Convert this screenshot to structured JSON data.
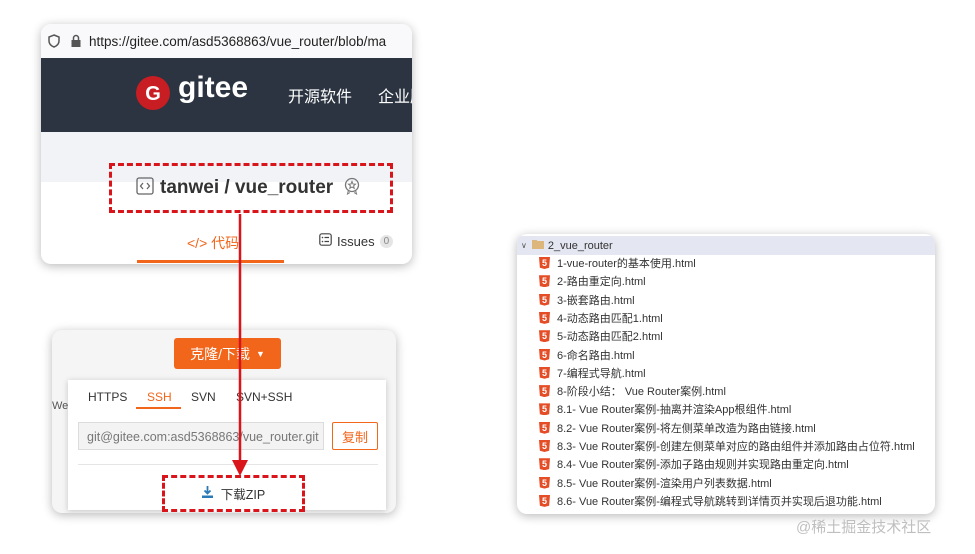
{
  "browser": {
    "url": "https://gitee.com/asd5368863/vue_router/blob/ma",
    "logo_text": "gitee",
    "nav": [
      "开源软件",
      "企业版"
    ],
    "repo_name": "tanwei / vue_router",
    "tab_code": "代码",
    "tab_issues": "Issues",
    "issues_count": "0"
  },
  "clone": {
    "button_label": "克隆/下载",
    "side_text": "We",
    "protocols": [
      "HTTPS",
      "SSH",
      "SVN",
      "SVN+SSH"
    ],
    "active_protocol": "SSH",
    "url_value": "git@gitee.com:asd5368863/vue_router.git",
    "copy_label": "复制",
    "download_zip_label": "下载ZIP"
  },
  "tree": {
    "folder": "2_vue_router",
    "files": [
      "1-vue-router的基本使用.html",
      "2-路由重定向.html",
      "3-嵌套路由.html",
      "4-动态路由匹配1.html",
      "5-动态路由匹配2.html",
      "6-命名路由.html",
      "7-编程式导航.html",
      "8-阶段小结： Vue Router案例.html",
      "8.1- Vue Router案例-抽离并渲染App根组件.html",
      "8.2- Vue Router案例-将左侧菜单改造为路由链接.html",
      "8.3- Vue Router案例-创建左侧菜单对应的路由组件并添加路由占位符.html",
      "8.4- Vue Router案例-添加子路由规则并实现路由重定向.html",
      "8.5- Vue Router案例-渲染用户列表数据.html",
      "8.6- Vue Router案例-编程式导航跳转到详情页并实现后退功能.html"
    ]
  },
  "watermark": "@稀土掘金技术社区",
  "colors": {
    "accent": "#f1661b",
    "highlight": "#d9151b",
    "navbar": "#2b3440",
    "html_icon": "#e44d26"
  }
}
